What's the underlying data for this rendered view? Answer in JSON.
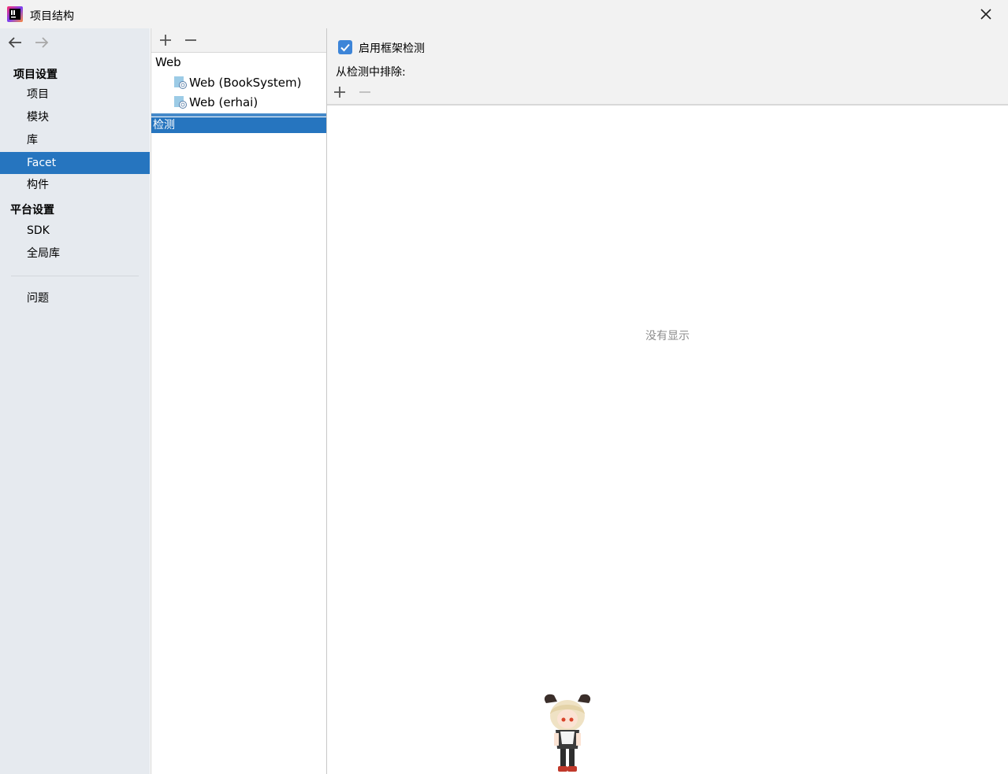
{
  "window": {
    "title": "项目结构",
    "app_icon": "intellij-idea-icon",
    "close_icon": "close-icon"
  },
  "sidebar": {
    "back_icon": "back-arrow-icon",
    "forward_icon": "forward-arrow-icon",
    "project_settings_title": "项目设置",
    "project_items": [
      {
        "label": "项目",
        "selected": false
      },
      {
        "label": "模块",
        "selected": false
      },
      {
        "label": "库",
        "selected": false
      },
      {
        "label": "Facet",
        "selected": true
      },
      {
        "label": "构件",
        "selected": false
      }
    ],
    "platform_settings_title": "平台设置",
    "platform_items": [
      {
        "label": "SDK"
      },
      {
        "label": "全局库"
      }
    ],
    "problems_label": "问题",
    "selected_color": "#2675bf"
  },
  "facet_tree": {
    "add_icon": "plus-icon",
    "remove_icon": "minus-icon",
    "root_label": "Web",
    "children": [
      {
        "label": "Web (BookSystem)",
        "icon": "web-facet-icon"
      },
      {
        "label": "Web (erhai)",
        "icon": "web-facet-icon"
      }
    ],
    "selected_label": "检测"
  },
  "detection": {
    "enable_label": "启用框架检测",
    "enable_checked": true,
    "exclude_label": "从检测中排除:",
    "add_icon": "plus-icon",
    "remove_icon": "minus-icon",
    "empty_text": "没有显示",
    "checkbox_color": "#3d85d8"
  },
  "overlay": {
    "mascot_icon": "chibi-character-icon"
  }
}
